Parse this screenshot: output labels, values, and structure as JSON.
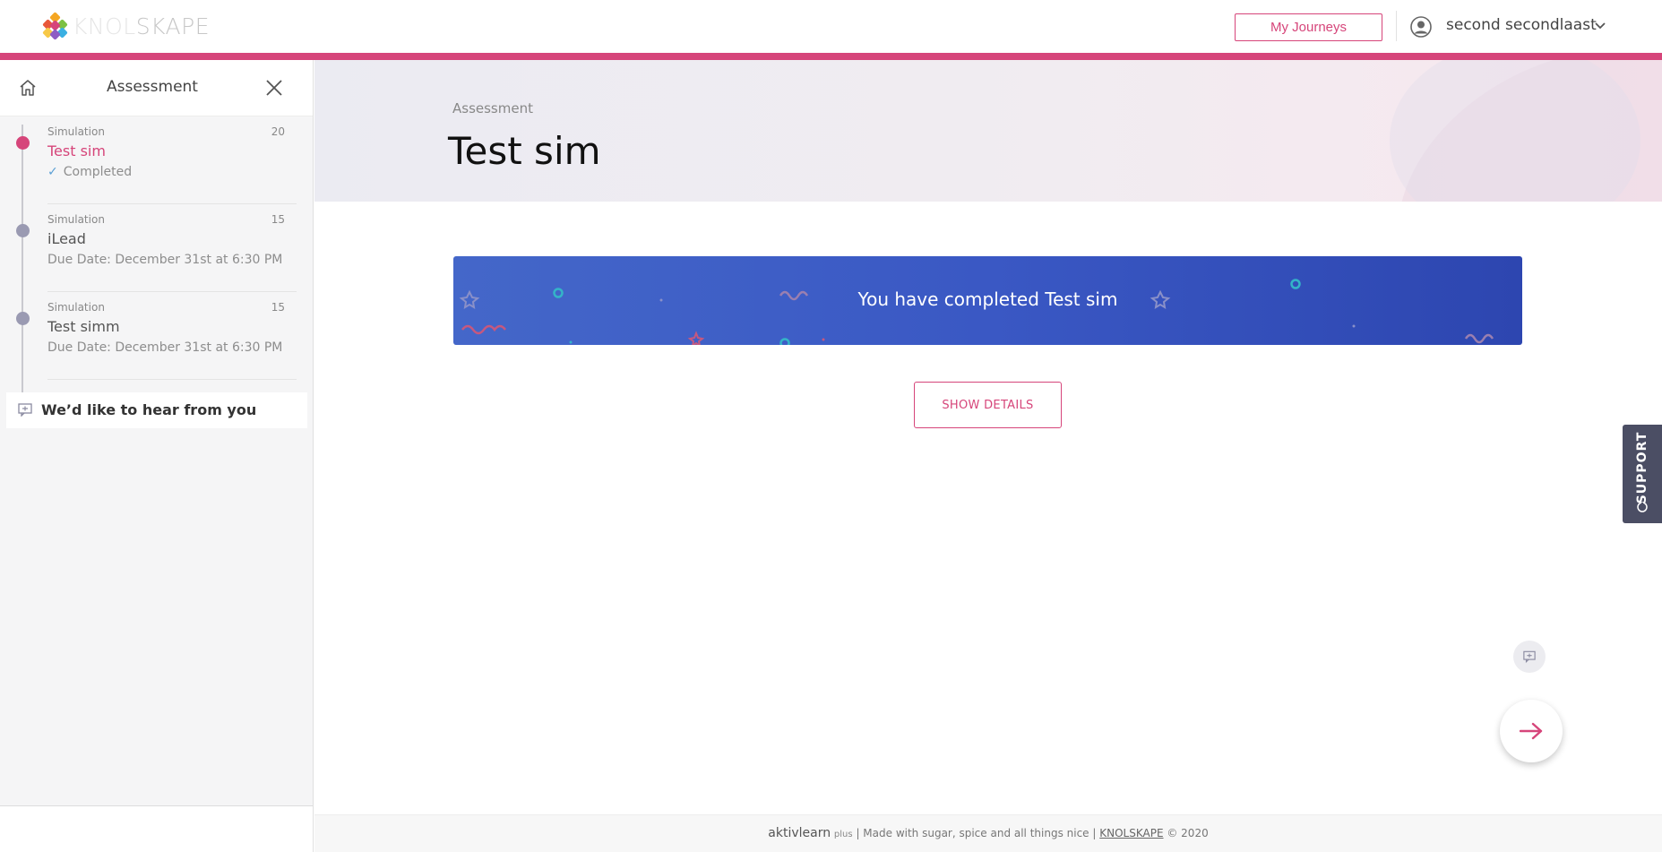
{
  "header": {
    "logo_text_a": "KNOL",
    "logo_text_b": "SKAPE",
    "my_journeys_label": "My Journeys",
    "user_name": "second secondlaast",
    "accent_color": "#d6457a"
  },
  "sidebar": {
    "title": "Assessment",
    "items": [
      {
        "type": "Simulation",
        "points": "20",
        "name": "Test sim",
        "status": "Completed",
        "state": "active"
      },
      {
        "type": "Simulation",
        "points": "15",
        "name": "iLead",
        "due": "Due Date: December 31st at 6:30 PM",
        "state": "pending"
      },
      {
        "type": "Simulation",
        "points": "15",
        "name": "Test simm",
        "due": "Due Date: December 31st at 6:30 PM",
        "state": "pending"
      }
    ],
    "feedback_label": "We’d like to hear from you"
  },
  "main": {
    "kicker": "Assessment",
    "title": "Test sim",
    "banner_text": "You have completed Test sim",
    "details_button": "SHOW DETAILS",
    "banner_color": "#3a58c4"
  },
  "support": {
    "label": "SUPPORT"
  },
  "footer": {
    "brand": "aktivlearn",
    "brand_suffix": "plus",
    "tagline": "| Made with sugar, spice and all things nice |",
    "company_link": "KNOLSKAPE",
    "copyright": "© 2020"
  },
  "icons": [
    "home-icon",
    "close-icon",
    "user-icon",
    "chevron-down-icon",
    "check-icon",
    "feedback-icon",
    "support-icon",
    "arrow-right-icon"
  ]
}
